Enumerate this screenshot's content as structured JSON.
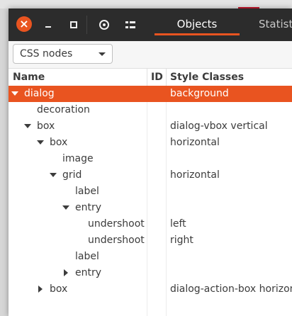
{
  "header": {
    "close_glyph": "×",
    "tabs": [
      {
        "label": "Objects",
        "active": true
      },
      {
        "label": "Statistics",
        "active": false
      }
    ]
  },
  "toolbar": {
    "dropdown_value": "CSS nodes"
  },
  "columns": [
    "Name",
    "ID",
    "Style Classes"
  ],
  "rows": [
    {
      "depth": 0,
      "expander": "expanded",
      "name": "dialog",
      "id": "",
      "classes": "background",
      "selected": true
    },
    {
      "depth": 1,
      "expander": "none",
      "name": "decoration",
      "id": "",
      "classes": ""
    },
    {
      "depth": 1,
      "expander": "expanded",
      "name": "box",
      "id": "",
      "classes": "dialog-vbox vertical"
    },
    {
      "depth": 2,
      "expander": "expanded",
      "name": "box",
      "id": "",
      "classes": "horizontal"
    },
    {
      "depth": 3,
      "expander": "none",
      "name": "image",
      "id": "",
      "classes": ""
    },
    {
      "depth": 3,
      "expander": "expanded",
      "name": "grid",
      "id": "",
      "classes": "horizontal"
    },
    {
      "depth": 4,
      "expander": "none",
      "name": "label",
      "id": "",
      "classes": ""
    },
    {
      "depth": 4,
      "expander": "expanded",
      "name": "entry",
      "id": "",
      "classes": ""
    },
    {
      "depth": 5,
      "expander": "none",
      "name": "undershoot",
      "id": "",
      "classes": "left"
    },
    {
      "depth": 5,
      "expander": "none",
      "name": "undershoot",
      "id": "",
      "classes": "right"
    },
    {
      "depth": 4,
      "expander": "none",
      "name": "label",
      "id": "",
      "classes": ""
    },
    {
      "depth": 4,
      "expander": "collapsed",
      "name": "entry",
      "id": "",
      "classes": ""
    },
    {
      "depth": 2,
      "expander": "collapsed",
      "name": "box",
      "id": "",
      "classes": "dialog-action-box horizontal"
    }
  ],
  "colors": {
    "accent": "#e95420",
    "headerbar": "#2c2c2c"
  },
  "icons": [
    "close-icon",
    "minimize-icon",
    "maximize-icon",
    "select-object-icon",
    "properties-icon",
    "dropdown-arrow-icon",
    "expander-down-icon",
    "expander-right-icon"
  ]
}
